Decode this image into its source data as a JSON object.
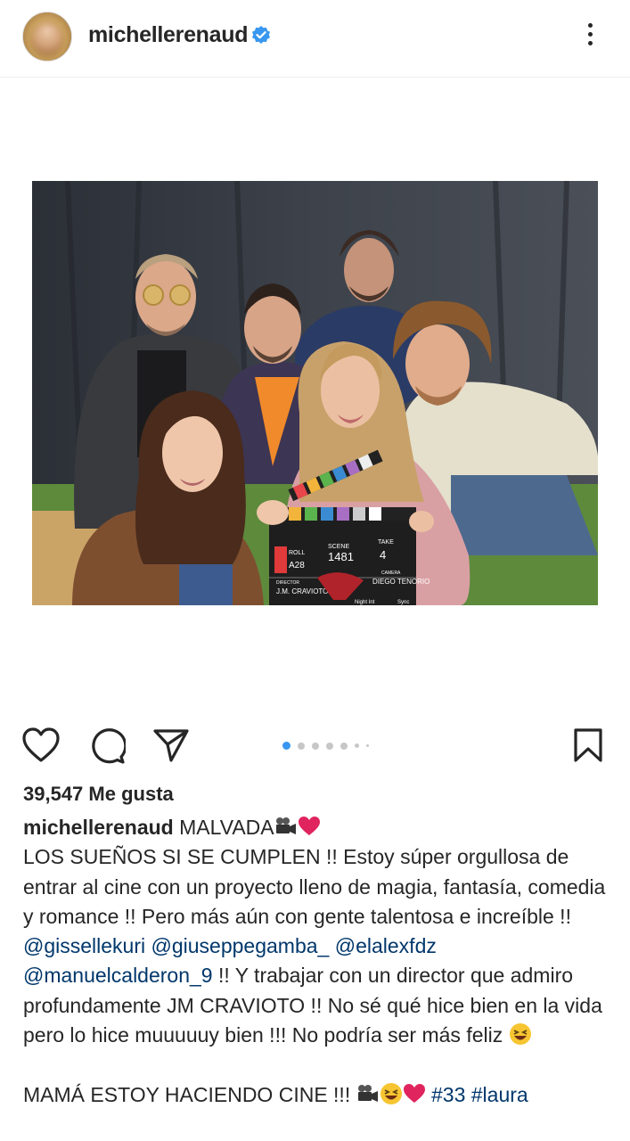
{
  "header": {
    "username": "michellerenaud"
  },
  "photo": {
    "clapper": {
      "roll_label": "ROLL",
      "roll_value": "A28",
      "scene_label": "SCENE",
      "scene_value": "1481",
      "take_label": "TAKE",
      "take_value": "4",
      "director_label": "DIRECTOR",
      "director_value": "J.M. CRAVIOTO",
      "camera_label": "CAMERA",
      "camera_value": "DIEGO TENORIO",
      "footer_left": "Night Int",
      "footer_right": "Sync"
    }
  },
  "carousel": {
    "count": 6,
    "active": 0
  },
  "likes": "39,547 Me gusta",
  "caption": {
    "username": "michellerenaud",
    "title": "MALVADA",
    "line1": "LOS SUEÑOS SI SE CUMPLEN !! Estoy súper orgullosa de entrar al cine con un proyecto lleno de magia, fantasía, comedia y romance !! Pero más aún con gente talentosa e increíble !! ",
    "mentions1": [
      "@gissellekuri",
      "@giuseppegamba_",
      "@elalexfdz"
    ],
    "mention4": "@manuelcalderon_9",
    "line2": " !! Y trabajar con un director que admiro profundamente JM CRAVIOTO !! No sé qué hice bien en la vida pero lo hice muuuuuy bien !!! No podría ser más feliz ",
    "line3": "MAMÁ ESTOY HACIENDO CINE !!! ",
    "hashtags": [
      "#33",
      "#laura"
    ]
  },
  "colors": {
    "verified": "#3897f0",
    "link": "#00376b",
    "heart": "#e0245e",
    "active_dot": "#3897f0"
  },
  "icons": [
    "heart-icon",
    "comment-icon",
    "share-icon",
    "bookmark-icon",
    "more-icon",
    "verified-icon"
  ]
}
